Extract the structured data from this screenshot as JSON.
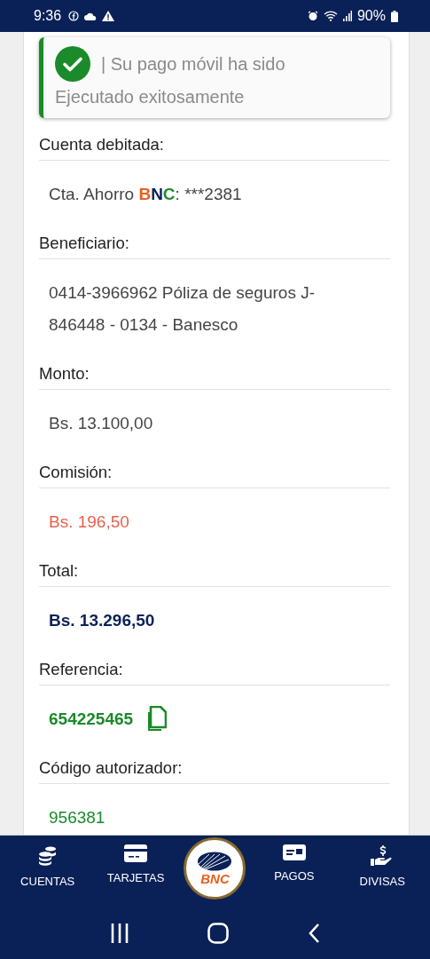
{
  "status_bar": {
    "time": "9:36",
    "battery": "90%"
  },
  "toast": {
    "message": "| Su pago móvil ha sido",
    "detail": "Ejecutado exitosamente"
  },
  "fields": [
    {
      "label": "Cuenta debitada:",
      "kind": "account",
      "parts": [
        {
          "text": "Cta. Ahorro "
        },
        {
          "text": "B",
          "color": "#e8601c"
        },
        {
          "text": "N",
          "color": "#0a2157"
        },
        {
          "text": "C",
          "color": "#1e8a2e"
        },
        {
          "text": ": ***2381"
        }
      ]
    },
    {
      "label": "Beneficiario:",
      "kind": "plain",
      "value": "0414-3966962 Póliza de seguros J-846448 - 0134 - Banesco"
    },
    {
      "label": "Monto:",
      "kind": "plain",
      "value": "Bs. 13.100,00"
    },
    {
      "label": "Comisión:",
      "kind": "fee",
      "value": "Bs. 196,50"
    },
    {
      "label": "Total:",
      "kind": "total",
      "value": "Bs. 13.296,50"
    },
    {
      "label": "Referencia:",
      "kind": "reference",
      "value": "654225465"
    },
    {
      "label": "Código autorizador:",
      "kind": "code",
      "value": "956381"
    }
  ],
  "nav": {
    "items": [
      {
        "label": "CUENTAS",
        "kind": "tab"
      },
      {
        "label": "TARJETAS",
        "kind": "tab"
      },
      {
        "label": "BNC",
        "kind": "logo"
      },
      {
        "label": "PAGOS",
        "kind": "tab"
      },
      {
        "label": "DIVISAS",
        "kind": "tab"
      }
    ]
  }
}
